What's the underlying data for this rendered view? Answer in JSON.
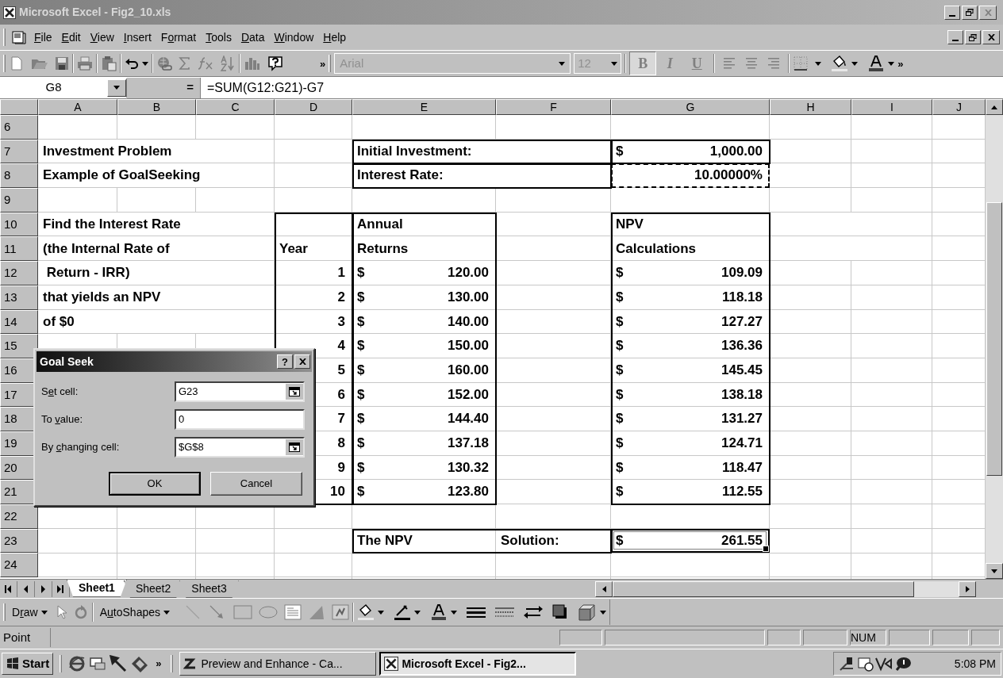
{
  "window": {
    "title": "Microsoft Excel - Fig2_10.xls"
  },
  "menu": [
    {
      "label": "File"
    },
    {
      "label": "Edit"
    },
    {
      "label": "View"
    },
    {
      "label": "Insert"
    },
    {
      "label": "Format"
    },
    {
      "label": "Tools"
    },
    {
      "label": "Data"
    },
    {
      "label": "Window"
    },
    {
      "label": "Help"
    }
  ],
  "toolbar": {
    "more": "»",
    "font": "Arial",
    "size": "12",
    "format_buttons": [
      {
        "label": "B",
        "on": true
      },
      {
        "label": "I",
        "on": false
      },
      {
        "label": "U",
        "on": false
      }
    ],
    "more_right": "»"
  },
  "formula_bar": {
    "name_box": "G8",
    "equals": "=",
    "formula": "=SUM(G12:G21)-G7"
  },
  "columns": [
    "A",
    "B",
    "C",
    "D",
    "E",
    "F",
    "G",
    "H",
    "I",
    "J"
  ],
  "rows": [
    {
      "header": "6"
    },
    {
      "header": "7",
      "A": {
        "kind": "text",
        "text": "Investment Problem",
        "selected": false,
        "marquee": false
      },
      "E": {
        "kind": "text",
        "text": "Initial Investment:",
        "selected": false,
        "marquee": false
      },
      "G": {
        "kind": "currency",
        "symbol": "$",
        "text": "1,000.00",
        "selected": false,
        "marquee": false
      }
    },
    {
      "header": "8",
      "A": {
        "kind": "text",
        "text": "Example of GoalSeeking",
        "selected": false,
        "marquee": false
      },
      "E": {
        "kind": "text",
        "text": "Interest Rate:",
        "selected": false,
        "marquee": false
      },
      "G": {
        "kind": "number",
        "text": "10.00000%",
        "selected": false,
        "marquee": true
      }
    },
    {
      "header": "9"
    },
    {
      "header": "10",
      "A": {
        "kind": "text",
        "text": "Find the Interest Rate",
        "selected": false,
        "marquee": false
      },
      "E": {
        "kind": "text",
        "text": "Annual",
        "selected": false,
        "marquee": false
      },
      "G": {
        "kind": "text",
        "text": "NPV",
        "selected": false,
        "marquee": false
      }
    },
    {
      "header": "11",
      "A": {
        "kind": "text",
        "text": "(the Internal Rate of",
        "selected": false,
        "marquee": false
      },
      "D": {
        "kind": "text",
        "text": "Year",
        "selected": false,
        "marquee": false
      },
      "E": {
        "kind": "text",
        "text": "Returns",
        "selected": false,
        "marquee": false
      },
      "G": {
        "kind": "text",
        "text": "Calculations",
        "selected": false,
        "marquee": false
      }
    },
    {
      "header": "12",
      "A": {
        "kind": "text",
        "text": " Return - IRR)",
        "selected": false,
        "marquee": false
      },
      "D": {
        "kind": "number",
        "text": "1",
        "selected": false,
        "marquee": false
      },
      "E": {
        "kind": "currency",
        "symbol": "$",
        "text": "120.00",
        "selected": false,
        "marquee": false
      },
      "G": {
        "kind": "currency",
        "symbol": "$",
        "text": "109.09",
        "selected": false,
        "marquee": false
      }
    },
    {
      "header": "13",
      "A": {
        "kind": "text",
        "text": "that yields an NPV",
        "selected": false,
        "marquee": false
      },
      "D": {
        "kind": "number",
        "text": "2",
        "selected": false,
        "marquee": false
      },
      "E": {
        "kind": "currency",
        "symbol": "$",
        "text": "130.00",
        "selected": false,
        "marquee": false
      },
      "G": {
        "kind": "currency",
        "symbol": "$",
        "text": "118.18",
        "selected": false,
        "marquee": false
      }
    },
    {
      "header": "14",
      "A": {
        "kind": "text",
        "text": "of $0",
        "selected": false,
        "marquee": false
      },
      "D": {
        "kind": "number",
        "text": "3",
        "selected": false,
        "marquee": false
      },
      "E": {
        "kind": "currency",
        "symbol": "$",
        "text": "140.00",
        "selected": false,
        "marquee": false
      },
      "G": {
        "kind": "currency",
        "symbol": "$",
        "text": "127.27",
        "selected": false,
        "marquee": false
      }
    },
    {
      "header": "15",
      "D": {
        "kind": "number",
        "text": "4",
        "selected": false,
        "marquee": false
      },
      "E": {
        "kind": "currency",
        "symbol": "$",
        "text": "150.00",
        "selected": false,
        "marquee": false
      },
      "G": {
        "kind": "currency",
        "symbol": "$",
        "text": "136.36",
        "selected": false,
        "marquee": false
      }
    },
    {
      "header": "16",
      "D": {
        "kind": "number",
        "text": "5",
        "selected": false,
        "marquee": false
      },
      "E": {
        "kind": "currency",
        "symbol": "$",
        "text": "160.00",
        "selected": false,
        "marquee": false
      },
      "G": {
        "kind": "currency",
        "symbol": "$",
        "text": "145.45",
        "selected": false,
        "marquee": false
      }
    },
    {
      "header": "17",
      "D": {
        "kind": "number",
        "text": "6",
        "selected": false,
        "marquee": false
      },
      "E": {
        "kind": "currency",
        "symbol": "$",
        "text": "152.00",
        "selected": false,
        "marquee": false
      },
      "G": {
        "kind": "currency",
        "symbol": "$",
        "text": "138.18",
        "selected": false,
        "marquee": false
      }
    },
    {
      "header": "18",
      "D": {
        "kind": "number",
        "text": "7",
        "selected": false,
        "marquee": false
      },
      "E": {
        "kind": "currency",
        "symbol": "$",
        "text": "144.40",
        "selected": false,
        "marquee": false
      },
      "G": {
        "kind": "currency",
        "symbol": "$",
        "text": "131.27",
        "selected": false,
        "marquee": false
      }
    },
    {
      "header": "19",
      "D": {
        "kind": "number",
        "text": "8",
        "selected": false,
        "marquee": false
      },
      "E": {
        "kind": "currency",
        "symbol": "$",
        "text": "137.18",
        "selected": false,
        "marquee": false
      },
      "G": {
        "kind": "currency",
        "symbol": "$",
        "text": "124.71",
        "selected": false,
        "marquee": false
      }
    },
    {
      "header": "20",
      "D": {
        "kind": "number",
        "text": "9",
        "selected": false,
        "marquee": false
      },
      "E": {
        "kind": "currency",
        "symbol": "$",
        "text": "130.32",
        "selected": false,
        "marquee": false
      },
      "G": {
        "kind": "currency",
        "symbol": "$",
        "text": "118.47",
        "selected": false,
        "marquee": false
      }
    },
    {
      "header": "21",
      "D": {
        "kind": "number",
        "text": "10",
        "selected": false,
        "marquee": false
      },
      "E": {
        "kind": "currency",
        "symbol": "$",
        "text": "123.80",
        "selected": false,
        "marquee": false
      },
      "G": {
        "kind": "currency",
        "symbol": "$",
        "text": "112.55",
        "selected": false,
        "marquee": false
      }
    },
    {
      "header": "22"
    },
    {
      "header": "23",
      "E": {
        "kind": "text",
        "text": "The NPV",
        "selected": false,
        "marquee": false
      },
      "F": {
        "kind": "text",
        "text": "Solution:",
        "selected": false,
        "marquee": false
      },
      "G": {
        "kind": "currency",
        "symbol": "$",
        "text": "261.55",
        "selected": true,
        "marquee": false
      }
    },
    {
      "header": "24"
    }
  ],
  "dialog": {
    "title": "Goal Seek",
    "help": "?",
    "fields": [
      {
        "label": "Set cell:",
        "value": "G23",
        "picker": true
      },
      {
        "label": "To value:",
        "value": "0",
        "picker": false
      },
      {
        "label": "By changing cell:",
        "value": "$G$8",
        "picker": true
      }
    ],
    "buttons": [
      {
        "label": "OK",
        "default": true
      },
      {
        "label": "Cancel",
        "default": false
      }
    ]
  },
  "sheet_tabs": [
    {
      "label": "Sheet1",
      "selected": true
    },
    {
      "label": "Sheet2",
      "selected": false
    },
    {
      "label": "Sheet3",
      "selected": false
    }
  ],
  "draw_toolbar": {
    "draw": {
      "label": "Draw"
    },
    "autoshapes": {
      "label": "AutoShapes"
    }
  },
  "status_bar": {
    "text": "Point",
    "num": "NUM"
  },
  "taskbar": {
    "start": "Start",
    "more": "»",
    "tasks": [
      {
        "label": "Preview and Enhance - Ca...",
        "selected": false
      },
      {
        "label": "Microsoft Excel - Fig2...",
        "selected": true
      }
    ],
    "clock": "5:08 PM"
  }
}
